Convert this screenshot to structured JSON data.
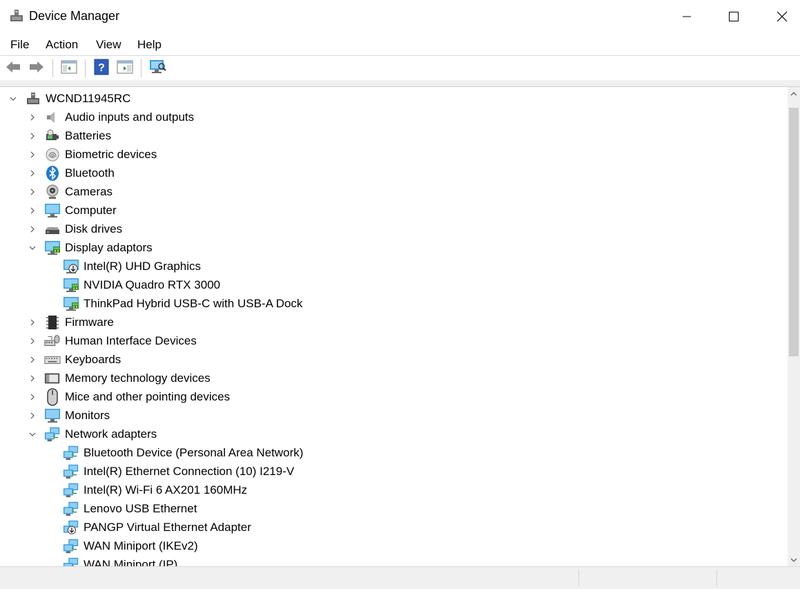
{
  "window": {
    "title": "Device Manager",
    "controls": [
      "minimize-icon",
      "maximize-icon",
      "close-icon"
    ]
  },
  "menu": {
    "file": "File",
    "action": "Action",
    "view": "View",
    "help": "Help"
  },
  "toolbar": {
    "buttons": [
      "back-arrow-icon",
      "forward-arrow-icon",
      "show-hide-console-tree-icon",
      "help-icon",
      "properties-pane-icon",
      "scan-hardware-icon"
    ]
  },
  "tree": {
    "root": "WCND11945RC",
    "categories": [
      {
        "label": "Audio inputs and outputs",
        "icon": "speaker-icon",
        "expanded": false
      },
      {
        "label": "Batteries",
        "icon": "battery-icon",
        "expanded": false
      },
      {
        "label": "Biometric devices",
        "icon": "fingerprint-icon",
        "expanded": false
      },
      {
        "label": "Bluetooth",
        "icon": "bluetooth-icon",
        "expanded": false
      },
      {
        "label": "Cameras",
        "icon": "webcam-icon",
        "expanded": false
      },
      {
        "label": "Computer",
        "icon": "computer-icon",
        "expanded": false
      },
      {
        "label": "Disk drives",
        "icon": "disk-drive-icon",
        "expanded": false
      },
      {
        "label": "Display adaptors",
        "icon": "display-adapter-icon",
        "expanded": true,
        "children": [
          {
            "label": "Intel(R) UHD Graphics",
            "icon": "display-adapter-disabled-icon"
          },
          {
            "label": "NVIDIA Quadro RTX 3000",
            "icon": "display-adapter-icon"
          },
          {
            "label": "ThinkPad Hybrid USB-C with USB-A Dock",
            "icon": "display-adapter-icon"
          }
        ]
      },
      {
        "label": "Firmware",
        "icon": "firmware-chip-icon",
        "expanded": false
      },
      {
        "label": "Human Interface Devices",
        "icon": "hid-icon",
        "expanded": false
      },
      {
        "label": "Keyboards",
        "icon": "keyboard-icon",
        "expanded": false
      },
      {
        "label": "Memory technology devices",
        "icon": "memory-card-icon",
        "expanded": false
      },
      {
        "label": "Mice and other pointing devices",
        "icon": "mouse-icon",
        "expanded": false
      },
      {
        "label": "Monitors",
        "icon": "monitor-icon",
        "expanded": false
      },
      {
        "label": "Network adapters",
        "icon": "network-adapter-icon",
        "expanded": true,
        "children": [
          {
            "label": "Bluetooth Device (Personal Area Network)",
            "icon": "network-adapter-icon"
          },
          {
            "label": "Intel(R) Ethernet Connection (10) I219-V",
            "icon": "network-adapter-icon"
          },
          {
            "label": "Intel(R) Wi-Fi 6 AX201 160MHz",
            "icon": "network-adapter-icon"
          },
          {
            "label": "Lenovo USB Ethernet",
            "icon": "network-adapter-icon"
          },
          {
            "label": "PANGP Virtual Ethernet Adapter",
            "icon": "network-adapter-disabled-icon"
          },
          {
            "label": "WAN Miniport (IKEv2)",
            "icon": "network-adapter-icon"
          },
          {
            "label": "WAN Miniport (IP)",
            "icon": "network-adapter-icon"
          }
        ]
      }
    ]
  },
  "colors": {
    "window_bg": "#ffffff",
    "chrome_bg": "#f0f0f0",
    "monitor_blue": "#3a9bdc",
    "monitor_screen": "#7fc8f0",
    "scroll_thumb": "#cdcdcd"
  }
}
